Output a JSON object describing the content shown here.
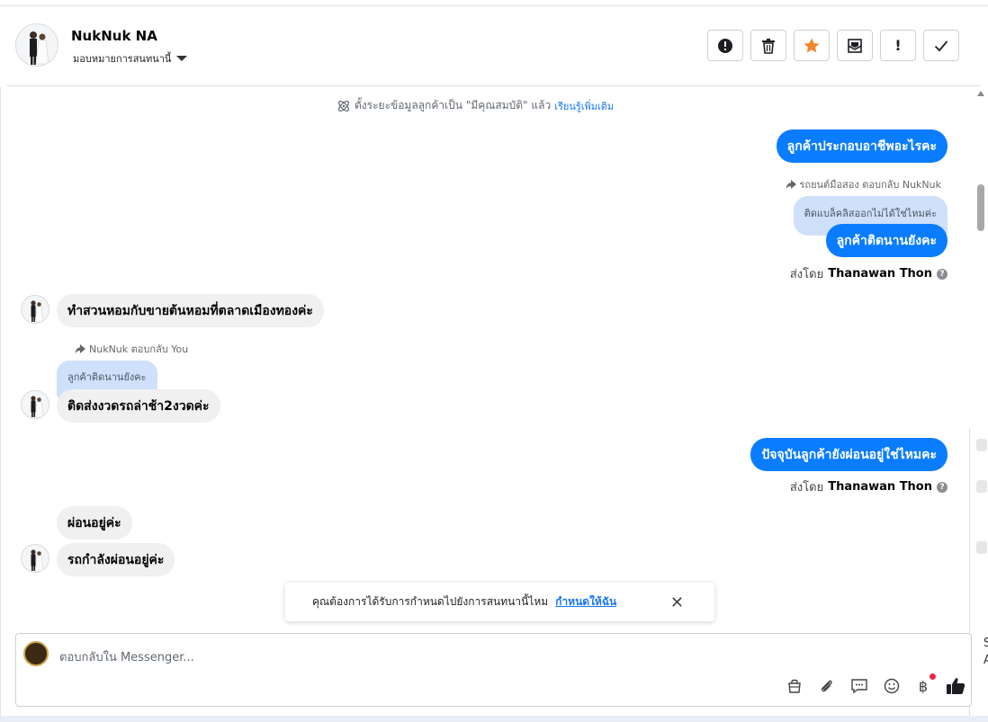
{
  "header": {
    "contact_name": "NukNuk NA",
    "assign_label": "มอบหมายการสนทนานี้",
    "toolbar": [
      {
        "name": "report-spam-button",
        "icon": "exclamation-circle-icon"
      },
      {
        "name": "delete-button",
        "icon": "trash-icon"
      },
      {
        "name": "star-button",
        "icon": "star-icon"
      },
      {
        "name": "mark-unread-button",
        "icon": "envelope-icon"
      },
      {
        "name": "flag-button",
        "icon": "exclamation-icon"
      },
      {
        "name": "mark-done-button",
        "icon": "check-icon"
      }
    ]
  },
  "chat": {
    "system_note": {
      "text": "ตั้งระยะข้อมูลลูกค้าเป็น \"มีคุณสมบัติ\" แล้ว",
      "link": "เรียนรู้เพิ่มเติม"
    },
    "messages": {
      "m1": "ลูกค้าประกอบอาชีพอะไรคะ",
      "reply1_meta": "รถยนต์มือสอง ตอบกลับ NukNuk",
      "reply1_quote": "ติดแบล็คลิสออกไม่ได้ใช่ไหมค่ะ",
      "m2": "ลูกค้าติดนานยังคะ",
      "sent_by_label": "ส่งโดย",
      "sent_by_name": "Thanawan Thon",
      "in1": "ทำสวนหอมกับขายต้นหอมที่ตลาดเมืองทองค่ะ",
      "reply2_meta": "NukNuk ตอบกลับ You",
      "reply2_quote": "ลูกค้าติดนานยังคะ",
      "in2": "ติดส่งงวดรถล่าช้า2งวดค่ะ",
      "m3": "ปัจจุบันลูกค้ายังผ่อนอยู่ใช่ไหมคะ",
      "sent_by_label2": "ส่งโดย",
      "sent_by_name2": "Thanawan Thon",
      "in3": "ผ่อนอยู่ค่ะ",
      "in4": "รถกำลังผ่อนอยู่ค่ะ"
    }
  },
  "toast": {
    "text": "คุณต้องการได้รับการกำหนดไปยังการสนทนานี้ไหม",
    "action": "กำหนดให้ฉัน"
  },
  "composer": {
    "placeholder": "ตอบกลับใน Messenger..."
  },
  "side_panel": {
    "peek_letters": [
      "S",
      "A"
    ]
  },
  "colors": {
    "outgoing_bubble": "#0a7cff",
    "incoming_bubble": "#f0f0f0",
    "quote_bubble": "#cfe0fb",
    "link": "#1877f2",
    "star": "#f5862a"
  }
}
